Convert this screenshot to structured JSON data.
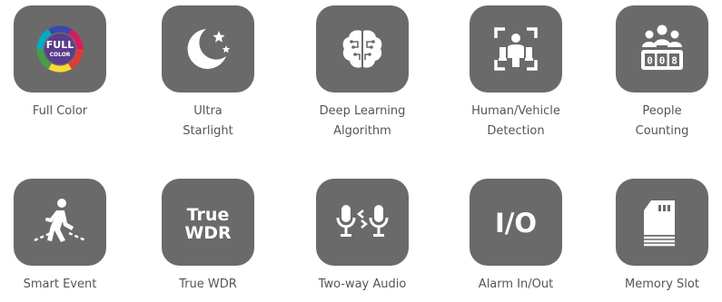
{
  "features": [
    {
      "icon": "full-color-icon",
      "lines": [
        "Full Color"
      ]
    },
    {
      "icon": "moon-stars-icon",
      "lines": [
        "Ultra",
        "Starlight"
      ]
    },
    {
      "icon": "brain-circuit-icon",
      "lines": [
        "Deep Learning",
        "Algorithm"
      ]
    },
    {
      "icon": "human-vehicle-detection-icon",
      "lines": [
        "Human/Vehicle",
        "Detection"
      ]
    },
    {
      "icon": "people-counter-icon",
      "lines": [
        "People",
        "Counting"
      ]
    },
    {
      "icon": "walking-person-icon",
      "lines": [
        "Smart Event"
      ]
    },
    {
      "icon": "true-wdr-icon",
      "text": [
        "True",
        "WDR"
      ],
      "lines": [
        "True WDR"
      ]
    },
    {
      "icon": "two-way-microphone-icon",
      "lines": [
        "Two-way Audio"
      ]
    },
    {
      "icon": "io-icon",
      "text": [
        "I/O"
      ],
      "lines": [
        "Alarm In/Out"
      ]
    },
    {
      "icon": "memory-card-icon",
      "lines": [
        "Memory Slot"
      ]
    }
  ],
  "full_color_badge": [
    "FULL",
    "COLOR"
  ],
  "counter_digits": [
    "0",
    "0",
    "8"
  ],
  "colors": {
    "tile": "#6a6a6a",
    "label": "#555555",
    "icon": "#ffffff"
  }
}
